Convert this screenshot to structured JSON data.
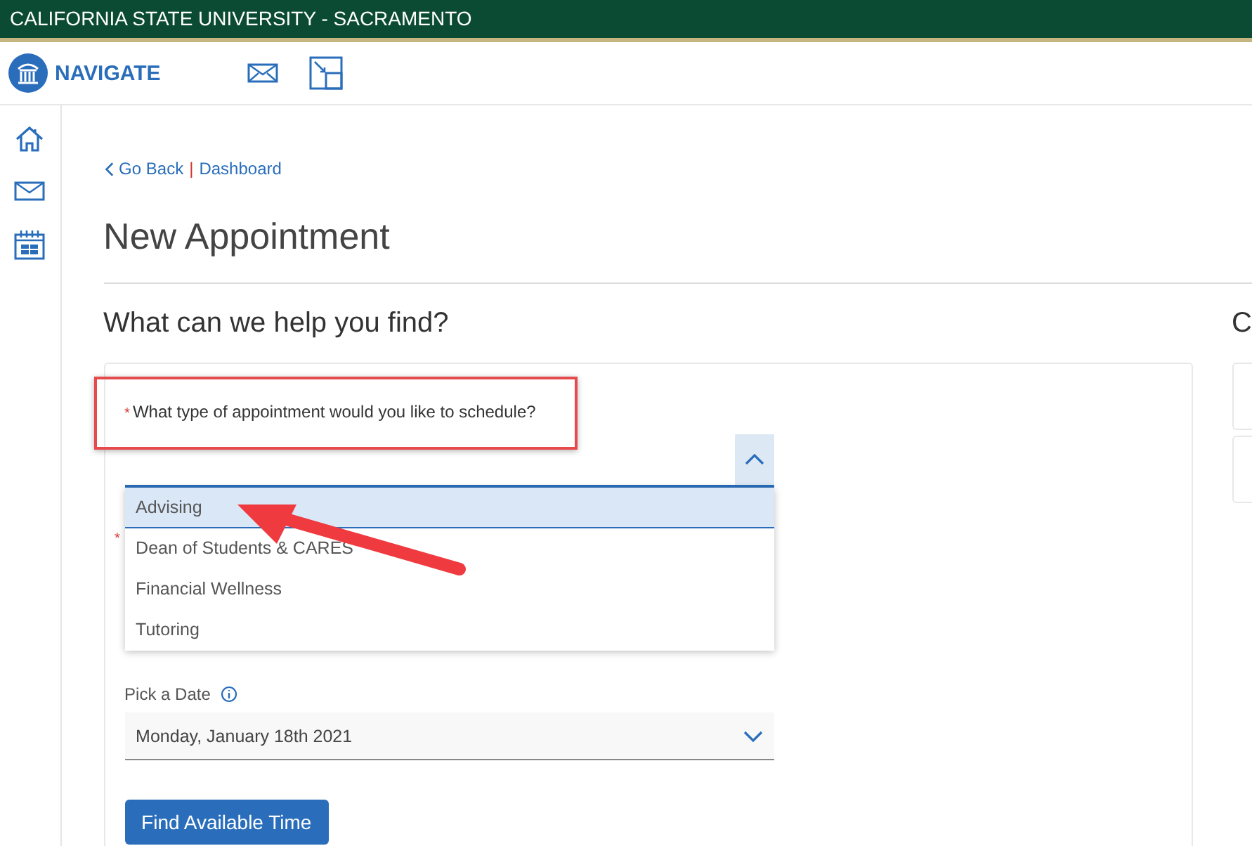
{
  "top_bar": {
    "title": "CALIFORNIA STATE UNIVERSITY - SACRAMENTO"
  },
  "header": {
    "brand": "NAVIGATE"
  },
  "breadcrumb": {
    "back": "Go Back",
    "separator": "|",
    "current": "Dashboard"
  },
  "page_title": "New Appointment",
  "section_title": "What can we help you find?",
  "side_heading": "C",
  "form": {
    "type_field": {
      "required_mark": "*",
      "label": "What type of appointment would you like to schedule?",
      "expanded": true,
      "options": [
        {
          "label": "Advising",
          "selected": true
        },
        {
          "label": "Dean of Students & CARES",
          "selected": false
        },
        {
          "label": "Financial Wellness",
          "selected": false
        },
        {
          "label": "Tutoring",
          "selected": false
        }
      ]
    },
    "hidden_field": {
      "required_mark": "*"
    },
    "date_field": {
      "label": "Pick a Date",
      "value": "Monday, January 18th 2021"
    },
    "submit": "Find Available Time"
  }
}
